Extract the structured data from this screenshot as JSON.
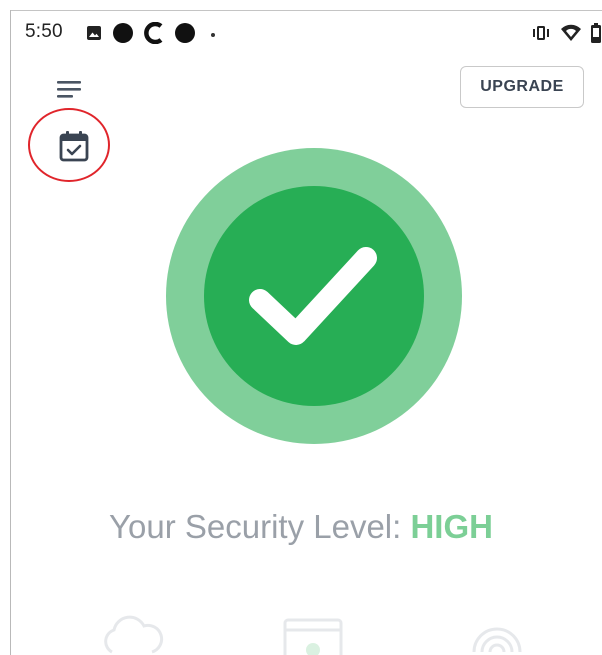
{
  "status_bar": {
    "time": "5:50",
    "left_icons": [
      "image-icon",
      "circle-icon",
      "c-icon",
      "circle-icon",
      "dot-icon"
    ],
    "right_icons": [
      "vibrate-icon",
      "wifi-icon",
      "battery-icon"
    ]
  },
  "header": {
    "menu_icon": "menu-icon",
    "upgrade_label": "UPGRADE",
    "calendar_icon": "calendar-check-icon"
  },
  "security": {
    "badge_icon": "checkmark-icon",
    "label": "Your Security Level: ",
    "level": "HIGH"
  },
  "bottom_icons": [
    "cloud-icon",
    "browser-icon",
    "fingerprint-icon"
  ],
  "colors": {
    "badge_outer": "#80cf9a",
    "badge_inner": "#27ae55",
    "level_text": "#7ccf96",
    "label_text": "#9aa0a8",
    "highlight_ring": "#e0252b",
    "upgrade_text": "#3a4452"
  }
}
